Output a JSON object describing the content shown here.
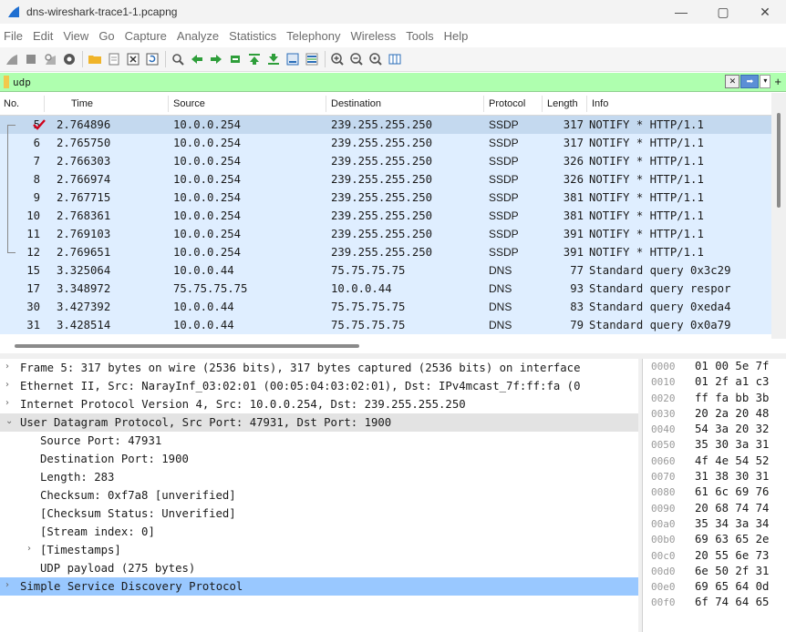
{
  "window": {
    "title": "dns-wireshark-trace1-1.pcapng",
    "minimize": "—",
    "maximize": "▢",
    "close": "✕"
  },
  "menu": [
    "File",
    "Edit",
    "View",
    "Go",
    "Capture",
    "Analyze",
    "Statistics",
    "Telephony",
    "Wireless",
    "Tools",
    "Help"
  ],
  "toolbar_icons": [
    "shark-fin-start-icon",
    "stop-icon",
    "restart-icon",
    "options-icon",
    "open-folder-icon",
    "file-icon",
    "close-file-icon",
    "reload-icon",
    "find-icon",
    "back-icon",
    "forward-icon",
    "goto-icon",
    "first-icon",
    "last-icon",
    "autoscroll-icon",
    "colorize-icon",
    "zoom-in-icon",
    "zoom-out-icon",
    "zoom-normal-icon",
    "resize-columns-icon"
  ],
  "filter": {
    "value": "udp",
    "background": "#afffaf"
  },
  "packet_list": {
    "columns": [
      "No.",
      "Time",
      "Source",
      "Destination",
      "Protocol",
      "Length",
      "Info"
    ],
    "rows": [
      {
        "no": "5",
        "time": "2.764896",
        "src": "10.0.0.254",
        "dst": "239.255.255.250",
        "proto": "SSDP",
        "len": "317",
        "info": "NOTIFY * HTTP/1.1",
        "selected": true
      },
      {
        "no": "6",
        "time": "2.765750",
        "src": "10.0.0.254",
        "dst": "239.255.255.250",
        "proto": "SSDP",
        "len": "317",
        "info": "NOTIFY * HTTP/1.1"
      },
      {
        "no": "7",
        "time": "2.766303",
        "src": "10.0.0.254",
        "dst": "239.255.255.250",
        "proto": "SSDP",
        "len": "326",
        "info": "NOTIFY * HTTP/1.1"
      },
      {
        "no": "8",
        "time": "2.766974",
        "src": "10.0.0.254",
        "dst": "239.255.255.250",
        "proto": "SSDP",
        "len": "326",
        "info": "NOTIFY * HTTP/1.1"
      },
      {
        "no": "9",
        "time": "2.767715",
        "src": "10.0.0.254",
        "dst": "239.255.255.250",
        "proto": "SSDP",
        "len": "381",
        "info": "NOTIFY * HTTP/1.1"
      },
      {
        "no": "10",
        "time": "2.768361",
        "src": "10.0.0.254",
        "dst": "239.255.255.250",
        "proto": "SSDP",
        "len": "381",
        "info": "NOTIFY * HTTP/1.1"
      },
      {
        "no": "11",
        "time": "2.769103",
        "src": "10.0.0.254",
        "dst": "239.255.255.250",
        "proto": "SSDP",
        "len": "391",
        "info": "NOTIFY * HTTP/1.1"
      },
      {
        "no": "12",
        "time": "2.769651",
        "src": "10.0.0.254",
        "dst": "239.255.255.250",
        "proto": "SSDP",
        "len": "391",
        "info": "NOTIFY * HTTP/1.1"
      },
      {
        "no": "15",
        "time": "3.325064",
        "src": "10.0.0.44",
        "dst": "75.75.75.75",
        "proto": "DNS",
        "len": "77",
        "info": "Standard query 0x3c29"
      },
      {
        "no": "17",
        "time": "3.348972",
        "src": "75.75.75.75",
        "dst": "10.0.0.44",
        "proto": "DNS",
        "len": "93",
        "info": "Standard query respor"
      },
      {
        "no": "30",
        "time": "3.427392",
        "src": "10.0.0.44",
        "dst": "75.75.75.75",
        "proto": "DNS",
        "len": "83",
        "info": "Standard query 0xeda4"
      },
      {
        "no": "31",
        "time": "3.428514",
        "src": "10.0.0.44",
        "dst": "75.75.75.75",
        "proto": "DNS",
        "len": "79",
        "info": "Standard query 0x0a79"
      }
    ]
  },
  "details": [
    {
      "text": "Frame 5: 317 bytes on wire (2536 bits), 317 bytes captured (2536 bits) on interface",
      "toggle": "›",
      "indent": 0
    },
    {
      "text": "Ethernet II, Src: NarayInf_03:02:01 (00:05:04:03:02:01), Dst: IPv4mcast_7f:ff:fa (0",
      "toggle": "›",
      "indent": 0
    },
    {
      "text": "Internet Protocol Version 4, Src: 10.0.0.254, Dst: 239.255.255.250",
      "toggle": "›",
      "indent": 0
    },
    {
      "text": "User Datagram Protocol, Src Port: 47931, Dst Port: 1900",
      "toggle": "⌄",
      "indent": 0,
      "state": "expanded"
    },
    {
      "text": "Source Port: 47931",
      "toggle": "",
      "indent": 1
    },
    {
      "text": "Destination Port: 1900",
      "toggle": "",
      "indent": 1
    },
    {
      "text": "Length: 283",
      "toggle": "",
      "indent": 1
    },
    {
      "text": "Checksum: 0xf7a8 [unverified]",
      "toggle": "",
      "indent": 1
    },
    {
      "text": "[Checksum Status: Unverified]",
      "toggle": "",
      "indent": 1
    },
    {
      "text": "[Stream index: 0]",
      "toggle": "",
      "indent": 1
    },
    {
      "text": "[Timestamps]",
      "toggle": "›",
      "indent": 1
    },
    {
      "text": "UDP payload (275 bytes)",
      "toggle": "",
      "indent": 1
    },
    {
      "text": "Simple Service Discovery Protocol",
      "toggle": "›",
      "indent": 0,
      "state": "highlighted"
    }
  ],
  "hex": [
    {
      "off": "0000",
      "bytes": "01 00 5e 7f"
    },
    {
      "off": "0010",
      "bytes": "01 2f a1 c3"
    },
    {
      "off": "0020",
      "bytes": "ff fa bb 3b"
    },
    {
      "off": "0030",
      "bytes": "20 2a 20 48"
    },
    {
      "off": "0040",
      "bytes": "54 3a 20 32"
    },
    {
      "off": "0050",
      "bytes": "35 30 3a 31"
    },
    {
      "off": "0060",
      "bytes": "4f 4e 54 52"
    },
    {
      "off": "0070",
      "bytes": "31 38 30 31"
    },
    {
      "off": "0080",
      "bytes": "61 6c 69 76"
    },
    {
      "off": "0090",
      "bytes": "20 68 74 74"
    },
    {
      "off": "00a0",
      "bytes": "35 34 3a 34"
    },
    {
      "off": "00b0",
      "bytes": "69 63 65 2e"
    },
    {
      "off": "00c0",
      "bytes": "20 55 6e 73"
    },
    {
      "off": "00d0",
      "bytes": "6e 50 2f 31"
    },
    {
      "off": "00e0",
      "bytes": "69 65 64 0d"
    },
    {
      "off": "00f0",
      "bytes": "6f 74 64 65"
    }
  ],
  "colors": {
    "row_bg": "#dfeeff",
    "row_selected": "#c4d9ef",
    "detail_highlight": "#99c8ff",
    "check_mark": "#d0021b"
  }
}
